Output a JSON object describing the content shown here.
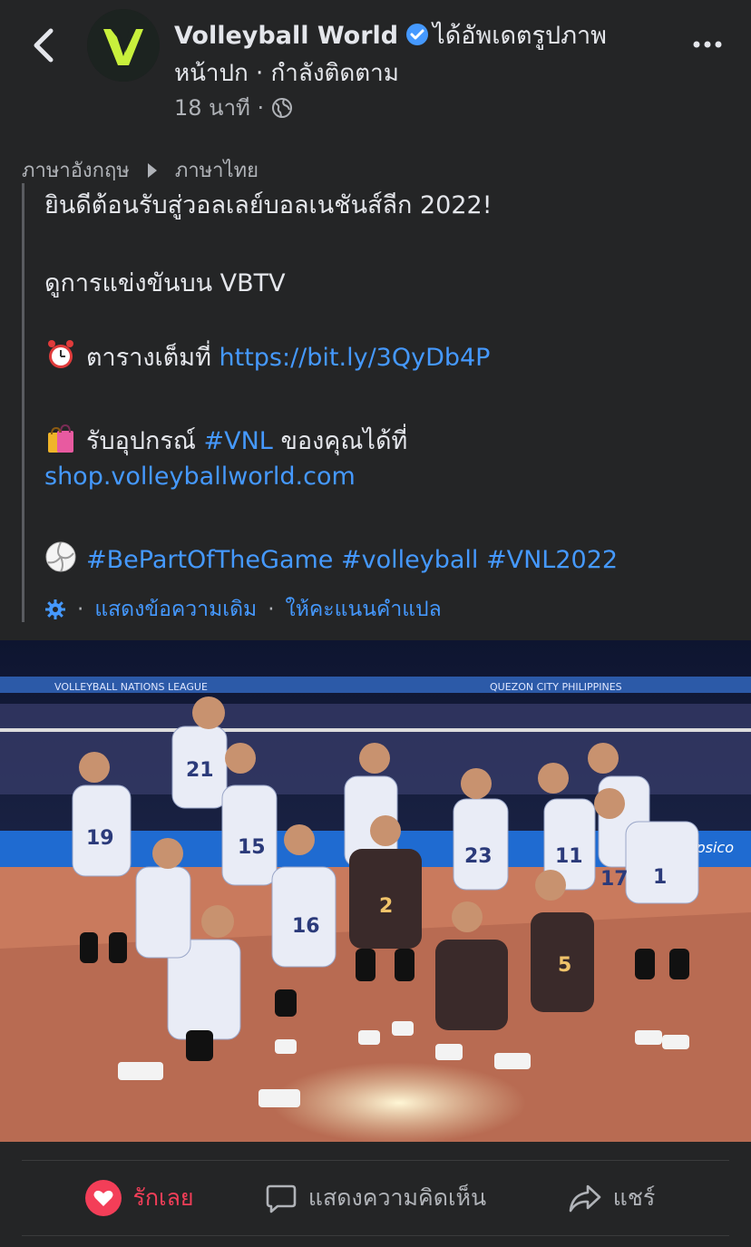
{
  "header": {
    "page_name": "Volleyball World",
    "action": "ได้อัพเดตรูปภาพ",
    "subline": "หน้าปก · กำลังติดตาม",
    "time": "18 นาที ·",
    "icons": [
      "back-arrow-icon",
      "verified-badge-icon",
      "globe-icon",
      "more-icon"
    ]
  },
  "translation": {
    "from_lang": "ภาษาอังกฤษ",
    "to_lang": "ภาษาไทย"
  },
  "post": {
    "line1": "ยินดีต้อนรับสู่วอลเลย์บอลเนชันส์ลีก 2022!",
    "line2": "ดูการแข่งขันบน VBTV",
    "schedule_prefix": "ตารางเต็มที่",
    "schedule_link": "https://bit.ly/3QyDb4P",
    "gear_prefix": "รับอุปกรณ์",
    "gear_hashtag": "#VNL",
    "gear_suffix": "ของคุณได้ที่",
    "shop_link": "shop.volleyballworld.com",
    "tag1": "#BePartOfTheGame",
    "tag2": "#volleyball",
    "tag3": "#VNL2022",
    "emojis": [
      "alarm-clock",
      "shopping-bags",
      "volleyball"
    ]
  },
  "translation_footer": {
    "show_original": "แสดงข้อความเดิม",
    "rate": "ให้คะแนนคำแปล"
  },
  "photo": {
    "banner_left": "VOLLEYBALL NATIONS LEAGUE",
    "banner_right": "QUEZON CITY PHILIPPINES",
    "sponsor": "Pepsico",
    "jerseys": [
      "21",
      "19",
      "15",
      "16",
      "2",
      "23",
      "17",
      "1",
      "5",
      "11"
    ]
  },
  "actions": {
    "like": "รักเลย",
    "comment": "แสดงความคิดเห็น",
    "share": "แชร์"
  },
  "colors": {
    "background": "#242526",
    "text": "#e4e6eb",
    "secondary": "#b0b3b8",
    "link": "#4599ff",
    "love": "#f33e58",
    "logo_green": "#c8f03c"
  }
}
